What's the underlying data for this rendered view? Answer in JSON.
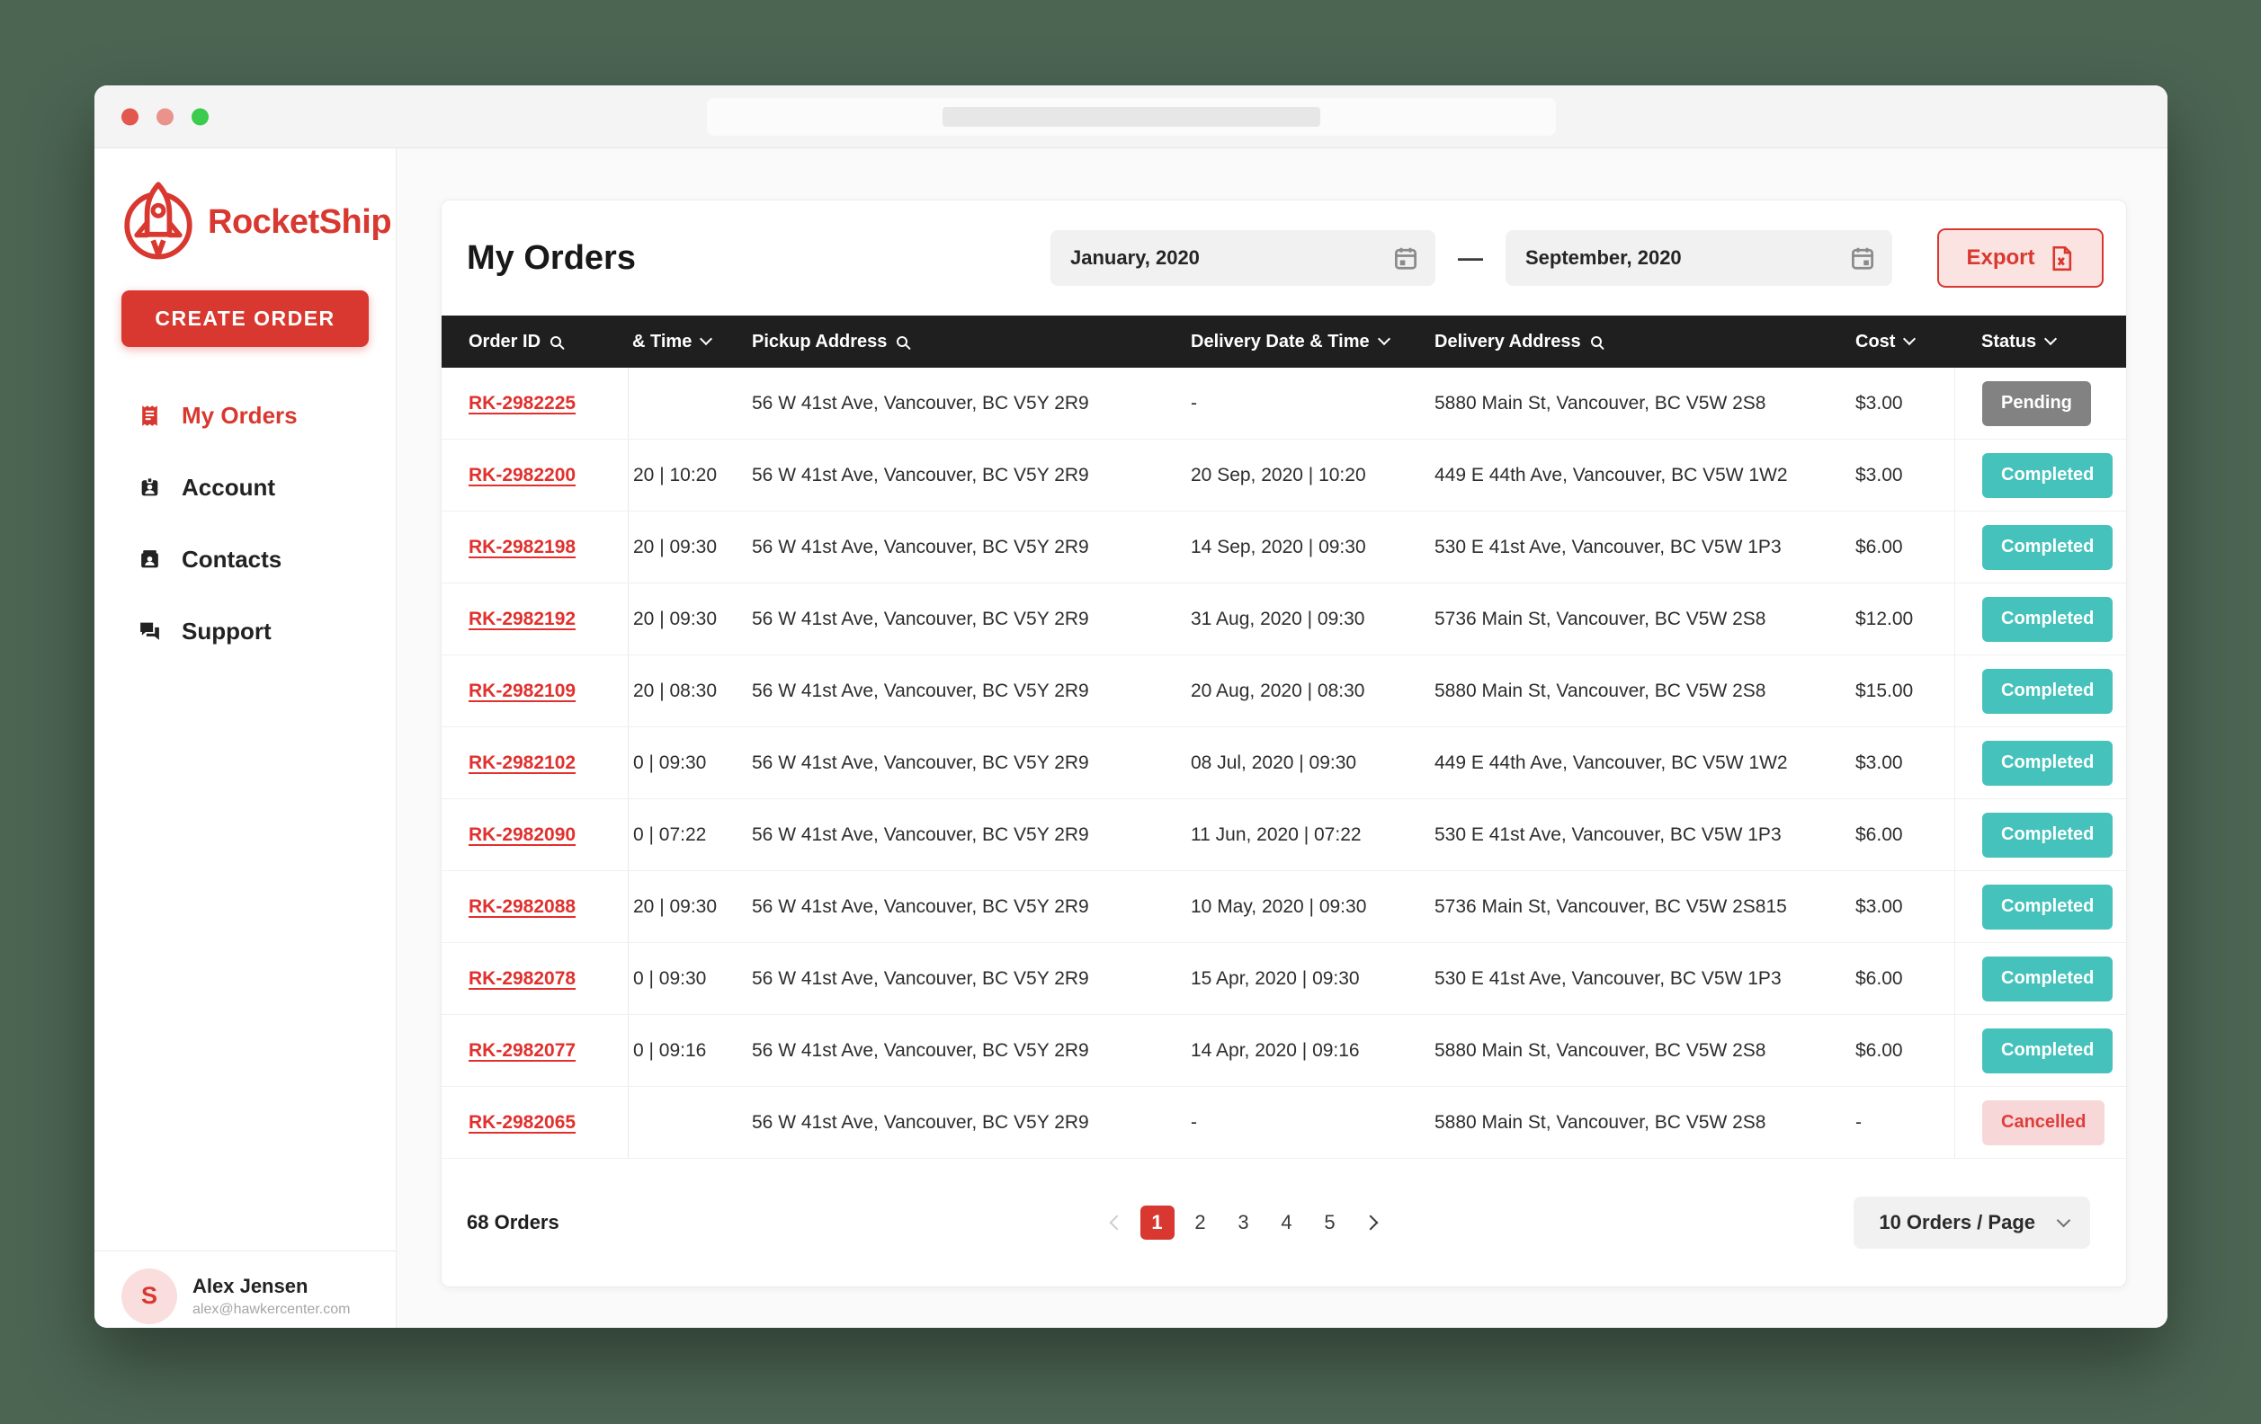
{
  "window": {
    "controls": [
      "close",
      "minimize",
      "zoom"
    ]
  },
  "brand": {
    "name": "RocketShip"
  },
  "sidebar": {
    "create_order": "CREATE ORDER",
    "items": [
      {
        "label": "My Orders",
        "icon": "receipt",
        "active": true
      },
      {
        "label": "Account",
        "icon": "badge",
        "active": false
      },
      {
        "label": "Contacts",
        "icon": "contact-card",
        "active": false
      },
      {
        "label": "Support",
        "icon": "chat",
        "active": false
      }
    ],
    "user": {
      "initial": "S",
      "name": "Alex Jensen",
      "email": "alex@hawkercenter.com"
    }
  },
  "header": {
    "title": "My Orders",
    "date_from": "January, 2020",
    "range_separator": "—",
    "date_to": "September, 2020",
    "export_label": "Export"
  },
  "table": {
    "columns": [
      {
        "label": "Order ID",
        "icon": "search"
      },
      {
        "label": "& Time",
        "icon": "chevron-down"
      },
      {
        "label": "Pickup Address",
        "icon": "search"
      },
      {
        "label": "Delivery Date & Time",
        "icon": "chevron-down"
      },
      {
        "label": "Delivery Address",
        "icon": "search"
      },
      {
        "label": "Cost",
        "icon": "chevron-down"
      },
      {
        "label": "Status",
        "icon": "chevron-down"
      }
    ],
    "rows": [
      {
        "order_id": "RK-2982225",
        "pickup_time": "",
        "pickup_address": "56 W 41st Ave, Vancouver, BC V5Y 2R9",
        "delivery_datetime": "-",
        "delivery_address": "5880 Main St, Vancouver, BC V5W 2S8",
        "cost": "$3.00",
        "status": "Pending"
      },
      {
        "order_id": "RK-2982200",
        "pickup_time": "20 | 10:20",
        "pickup_address": "56 W 41st Ave, Vancouver, BC V5Y 2R9",
        "delivery_datetime": "20 Sep, 2020 | 10:20",
        "delivery_address": "449 E 44th Ave, Vancouver, BC V5W 1W2",
        "cost": "$3.00",
        "status": "Completed"
      },
      {
        "order_id": "RK-2982198",
        "pickup_time": "20 | 09:30",
        "pickup_address": "56 W 41st Ave, Vancouver, BC V5Y 2R9",
        "delivery_datetime": "14 Sep, 2020 | 09:30",
        "delivery_address": "530 E 41st Ave, Vancouver, BC V5W 1P3",
        "cost": "$6.00",
        "status": "Completed"
      },
      {
        "order_id": "RK-2982192",
        "pickup_time": "20 | 09:30",
        "pickup_address": "56 W 41st Ave, Vancouver, BC V5Y 2R9",
        "delivery_datetime": "31 Aug, 2020 | 09:30",
        "delivery_address": "5736 Main St, Vancouver, BC V5W 2S8",
        "cost": "$12.00",
        "status": "Completed"
      },
      {
        "order_id": "RK-2982109",
        "pickup_time": "20 | 08:30",
        "pickup_address": "56 W 41st Ave, Vancouver, BC V5Y 2R9",
        "delivery_datetime": "20 Aug, 2020 | 08:30",
        "delivery_address": "5880 Main St, Vancouver, BC V5W 2S8",
        "cost": "$15.00",
        "status": "Completed"
      },
      {
        "order_id": "RK-2982102",
        "pickup_time": "0 | 09:30",
        "pickup_address": "56 W 41st Ave, Vancouver, BC V5Y 2R9",
        "delivery_datetime": "08 Jul, 2020 | 09:30",
        "delivery_address": "449 E 44th Ave, Vancouver, BC V5W 1W2",
        "cost": "$3.00",
        "status": "Completed"
      },
      {
        "order_id": "RK-2982090",
        "pickup_time": "0 | 07:22",
        "pickup_address": "56 W 41st Ave, Vancouver, BC V5Y 2R9",
        "delivery_datetime": "11 Jun, 2020 | 07:22",
        "delivery_address": "530 E 41st Ave, Vancouver, BC V5W 1P3",
        "cost": "$6.00",
        "status": "Completed"
      },
      {
        "order_id": "RK-2982088",
        "pickup_time": "20 | 09:30",
        "pickup_address": "56 W 41st Ave, Vancouver, BC V5Y 2R9",
        "delivery_datetime": "10 May, 2020 | 09:30",
        "delivery_address": "5736 Main St, Vancouver, BC V5W 2S815",
        "cost": "$3.00",
        "status": "Completed"
      },
      {
        "order_id": "RK-2982078",
        "pickup_time": "0 | 09:30",
        "pickup_address": "56 W 41st Ave, Vancouver, BC V5Y 2R9",
        "delivery_datetime": "15 Apr, 2020 | 09:30",
        "delivery_address": "530 E 41st Ave, Vancouver, BC V5W 1P3",
        "cost": "$6.00",
        "status": "Completed"
      },
      {
        "order_id": "RK-2982077",
        "pickup_time": "0 | 09:16",
        "pickup_address": "56 W 41st Ave, Vancouver, BC V5Y 2R9",
        "delivery_datetime": "14 Apr, 2020 | 09:16",
        "delivery_address": "5880 Main St, Vancouver, BC V5W 2S8",
        "cost": "$6.00",
        "status": "Completed"
      },
      {
        "order_id": "RK-2982065",
        "pickup_time": "",
        "pickup_address": "56 W 41st Ave, Vancouver, BC V5Y 2R9",
        "delivery_datetime": "-",
        "delivery_address": "5880 Main St, Vancouver, BC V5W 2S8",
        "cost": "-",
        "status": "Cancelled"
      }
    ]
  },
  "footer": {
    "orders_count": "68 Orders",
    "pages": [
      "1",
      "2",
      "3",
      "4",
      "5"
    ],
    "active_page": "1",
    "per_page": "10 Orders / Page"
  },
  "colors": {
    "accent_red": "#D8382F",
    "export_bg": "#FAE3E1",
    "teal": "#45C2BC",
    "pending_gray": "#828282",
    "cancelled_bg": "#F8D7D8",
    "cancelled_text": "#E13C3C",
    "header_dark": "#1F1F1F",
    "desktop_green": "#4C6553"
  }
}
